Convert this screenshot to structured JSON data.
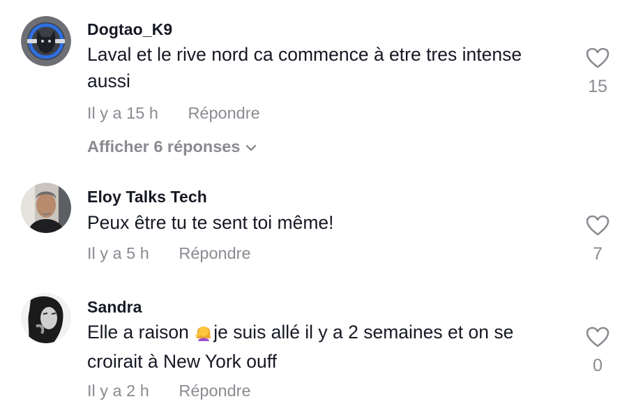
{
  "comments": [
    {
      "username": "Dogtao_K9",
      "text": "Laval et le rive nord ca commence à etre tres intense aussi",
      "time": "Il y a 15 h",
      "reply_label": "Répondre",
      "likes": "15",
      "view_replies": "Afficher 6 réponses",
      "avatar_icon": "dog-logo-avatar"
    },
    {
      "username": "Eloy Talks Tech",
      "text": "Peux être tu te sent toi même!",
      "time": "Il y a 5 h",
      "reply_label": "Répondre",
      "likes": "7",
      "avatar_icon": "man-photo-avatar"
    },
    {
      "username": "Sandra",
      "text_before_emoji": "Elle a raison ",
      "emoji": "woman-tipping-hand-emoji",
      "text_after_emoji": "je suis allé il y a 2 semaines et on se croirait à New York ouff",
      "time": "Il y a 2 h",
      "reply_label": "Répondre",
      "likes": "0",
      "avatar_icon": "woman-photo-avatar"
    }
  ],
  "colors": {
    "primary_text": "#161823",
    "secondary_text": "#8a8b91",
    "background": "#ffffff"
  }
}
